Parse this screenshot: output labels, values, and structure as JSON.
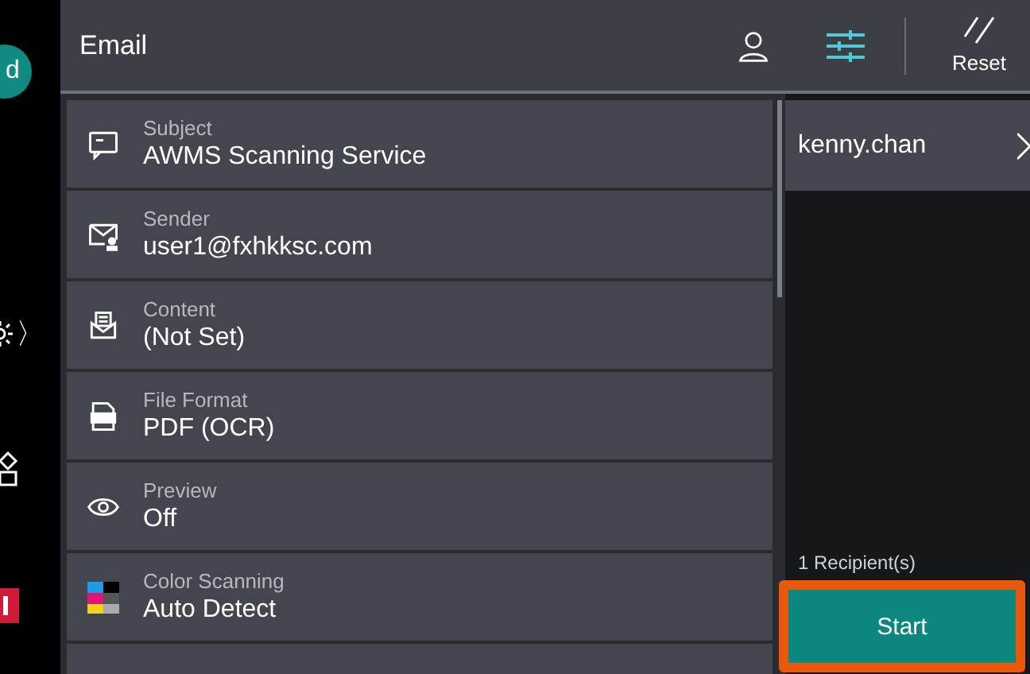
{
  "side_rail": {
    "avatar_letter": "d",
    "chevron": "〉"
  },
  "header": {
    "title": "Email",
    "view_buttons": [
      {
        "kind": "person",
        "selected": false
      },
      {
        "kind": "sliders",
        "selected": true
      }
    ],
    "reset_label": "Reset"
  },
  "settings": [
    {
      "kind": "subject",
      "label": "Subject",
      "value": "AWMS Scanning Service"
    },
    {
      "kind": "sender",
      "label": "Sender",
      "value": "user1@fxhkksc.com"
    },
    {
      "kind": "content",
      "label": "Content",
      "value": "(Not Set)"
    },
    {
      "kind": "file",
      "label": "File Format",
      "value": "PDF (OCR)"
    },
    {
      "kind": "preview",
      "label": "Preview",
      "value": "Off"
    },
    {
      "kind": "color",
      "label": "Color Scanning",
      "value": "Auto Detect"
    }
  ],
  "recipients": [
    {
      "name": "kenny.chan"
    }
  ],
  "recipient_count": "1 Recipient(s)",
  "start_button": {
    "label": "Start",
    "highlighted": true
  }
}
